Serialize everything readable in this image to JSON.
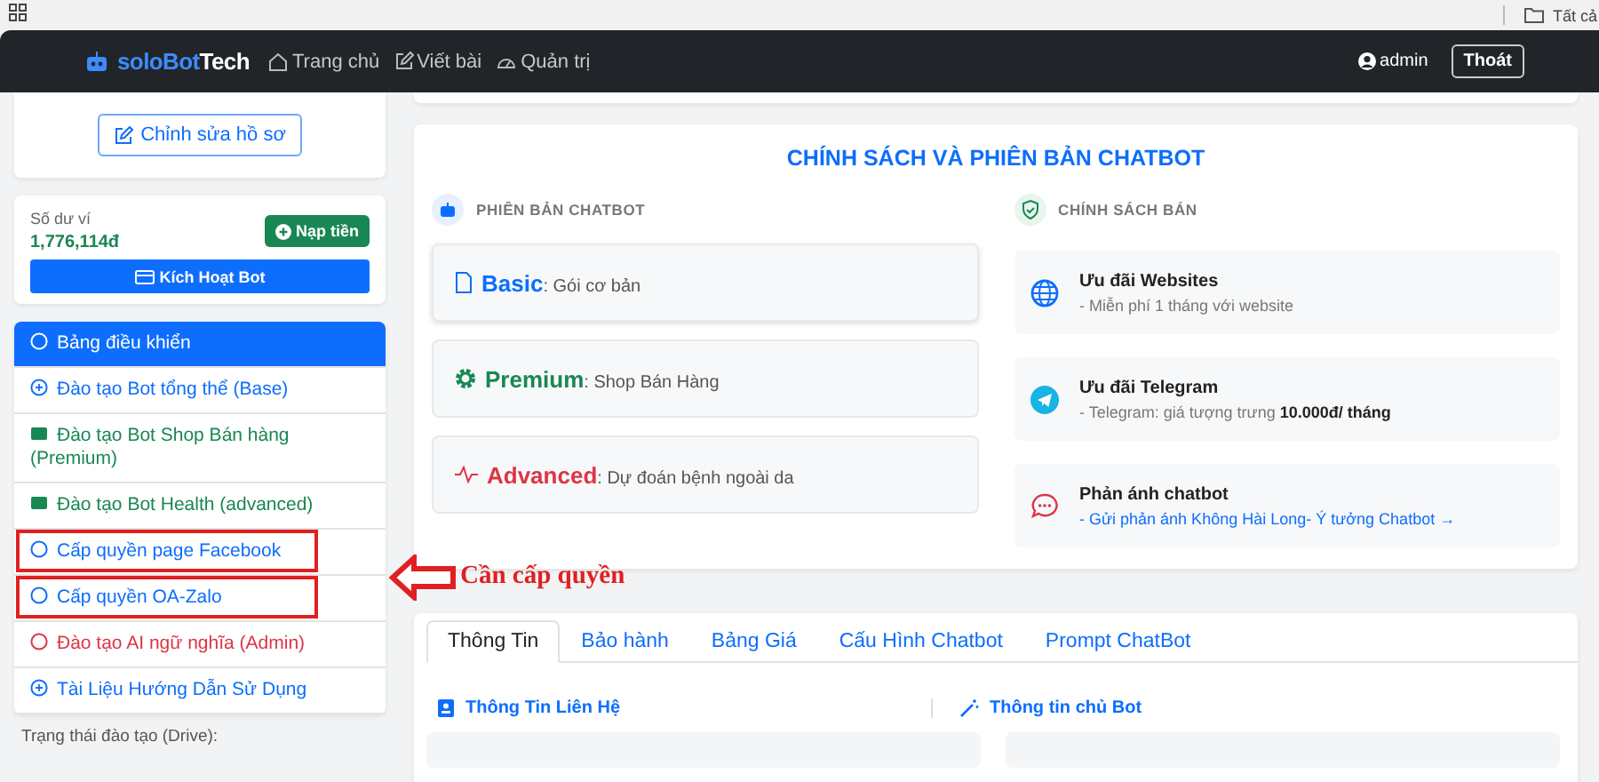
{
  "browser_bar": {
    "bookmark": "Tất cả"
  },
  "navbar": {
    "brand_first": "soloBot",
    "brand_second": "Tech",
    "links": [
      "Trang chủ",
      "Viết bài",
      "Quản trị"
    ],
    "user": "admin",
    "logout": "Thoát"
  },
  "profile": {
    "edit_button": "Chỉnh sửa hồ sơ"
  },
  "wallet": {
    "label": "Số dư ví",
    "balance": "1,776,114đ",
    "topup_button": "Nạp tiền",
    "activate_button": "Kích Hoạt Bot"
  },
  "menu": [
    {
      "label": "Bảng điều khiển",
      "selected": true,
      "annotated": false,
      "color": "#0d6efd"
    },
    {
      "label": "Đào tạo Bot tổng thể (Base)",
      "selected": false,
      "annotated": false,
      "color": "#0d6efd"
    },
    {
      "label": "Đào tạo Bot Shop Bán hàng (Premium)",
      "selected": false,
      "annotated": false,
      "color": "#198754"
    },
    {
      "label": "Đào tạo Bot Health (advanced)",
      "selected": false,
      "annotated": false,
      "color": "#198754"
    },
    {
      "label": "Cấp quyền page Facebook",
      "selected": false,
      "annotated": true,
      "color": "#0d6efd"
    },
    {
      "label": "Cấp quyền OA-Zalo",
      "selected": false,
      "annotated": true,
      "color": "#0d6efd"
    },
    {
      "label": "Đào tạo AI ngữ nghĩa (Admin)",
      "selected": false,
      "annotated": false,
      "color": "#dc3545"
    },
    {
      "label": "Tài Liệu Hướng Dẫn Sử Dụng",
      "selected": false,
      "annotated": false,
      "color": "#0d6efd"
    }
  ],
  "training_status": "Trạng thái đào tạo (Drive):",
  "annotation": {
    "text": "Cần cấp quyền"
  },
  "policy": {
    "title": "CHÍNH SÁCH VÀ PHIÊN BẢN CHATBOT",
    "versions_heading": "PHIÊN BẢN CHATBOT",
    "versions": [
      {
        "name": "Basic",
        "description": ": Gói cơ bản",
        "color": "#0d6efd"
      },
      {
        "name": "Premium",
        "description": ": Shop Bán Hàng",
        "color": "#198754"
      },
      {
        "name": "Advanced",
        "description": ": Dự đoán bệnh ngoài da",
        "color": "#dc3545"
      }
    ],
    "sales_heading": "CHÍNH SÁCH BÁN",
    "offers": [
      {
        "kind": "text",
        "title": "Ưu đãi Websites",
        "detail": "- Miễn phí 1 tháng với website"
      },
      {
        "kind": "text",
        "title": "Ưu đãi Telegram",
        "detail": "- Telegram: giá tượng trưng **10.000đ/ tháng**"
      },
      {
        "kind": "link",
        "title": "Phản ánh chatbot",
        "detail": "- Gửi phản ánh Không Hài Long- Ý tưởng Chatbot →"
      }
    ]
  },
  "tabs": [
    {
      "label": "Thông Tin",
      "selected": true
    },
    {
      "label": "Bảo hành",
      "selected": false
    },
    {
      "label": "Bảng Giá",
      "selected": false
    },
    {
      "label": "Cấu Hình Chatbot",
      "selected": false
    },
    {
      "label": "Prompt ChatBot",
      "selected": false
    }
  ],
  "info_sections": [
    "Thông Tin Liên Hệ",
    "Thông tin chủ Bot"
  ]
}
